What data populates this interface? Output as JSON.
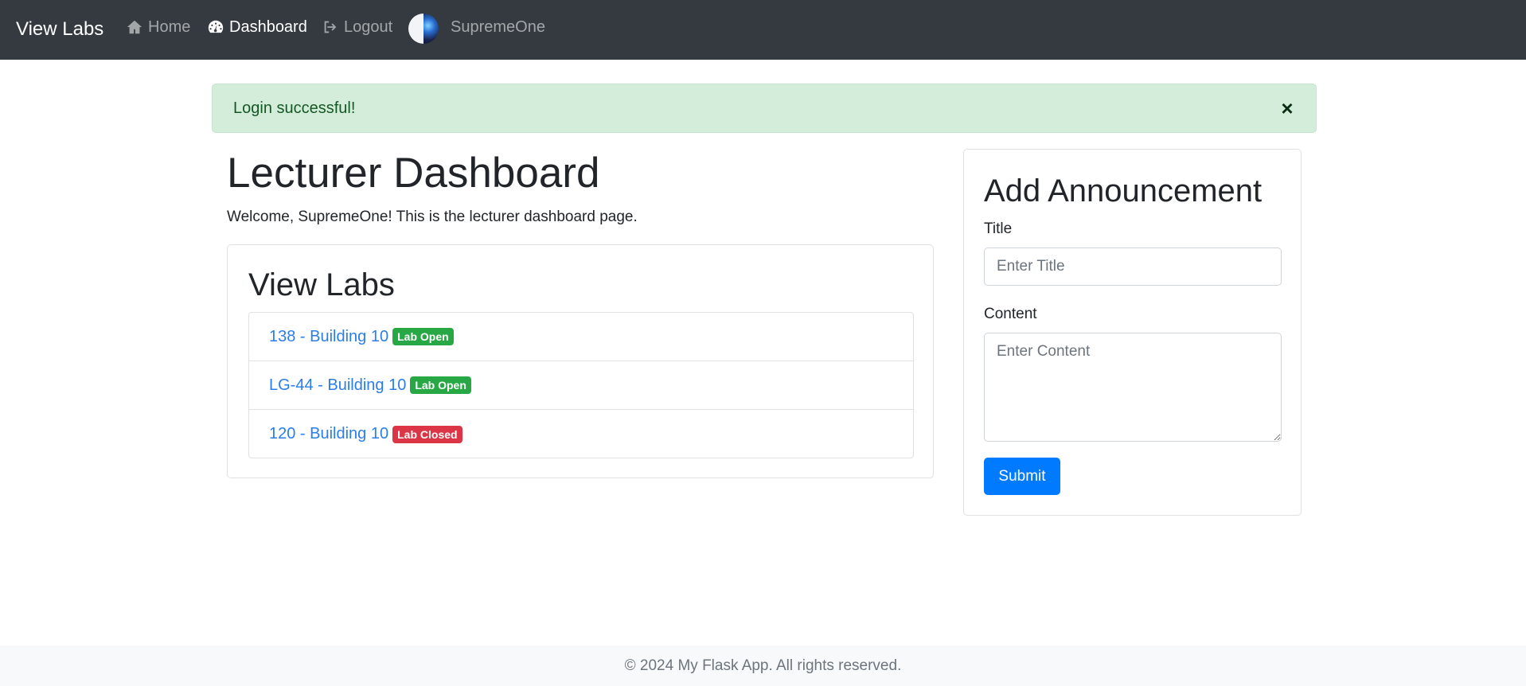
{
  "navbar": {
    "brand": "View Labs",
    "items": [
      {
        "label": "Home",
        "icon": "home-icon",
        "active": false
      },
      {
        "label": "Dashboard",
        "icon": "dashboard-icon",
        "active": true
      },
      {
        "label": "Logout",
        "icon": "logout-icon",
        "active": false
      }
    ],
    "username": "SupremeOne"
  },
  "alert": {
    "message": "Login successful!",
    "close_glyph": "×",
    "color": "#155724",
    "background": "#d4edda"
  },
  "main": {
    "title": "Lecturer Dashboard",
    "welcome": "Welcome, SupremeOne! This is the lecturer dashboard page.",
    "labs_card": {
      "title": "View Labs",
      "labs": [
        {
          "name": "138 - Building 10",
          "status": "Lab Open",
          "status_color": "#28a745"
        },
        {
          "name": "LG-44 - Building 10",
          "status": "Lab Open",
          "status_color": "#28a745"
        },
        {
          "name": "120 - Building 10",
          "status": "Lab Closed",
          "status_color": "#dc3545"
        }
      ]
    }
  },
  "announcement": {
    "title": "Add Announcement",
    "title_label": "Title",
    "title_placeholder": "Enter Title",
    "content_label": "Content",
    "content_placeholder": "Enter Content",
    "submit_label": "Submit",
    "accent": "#007bff"
  },
  "footer": {
    "text": "© 2024 My Flask App. All rights reserved."
  }
}
